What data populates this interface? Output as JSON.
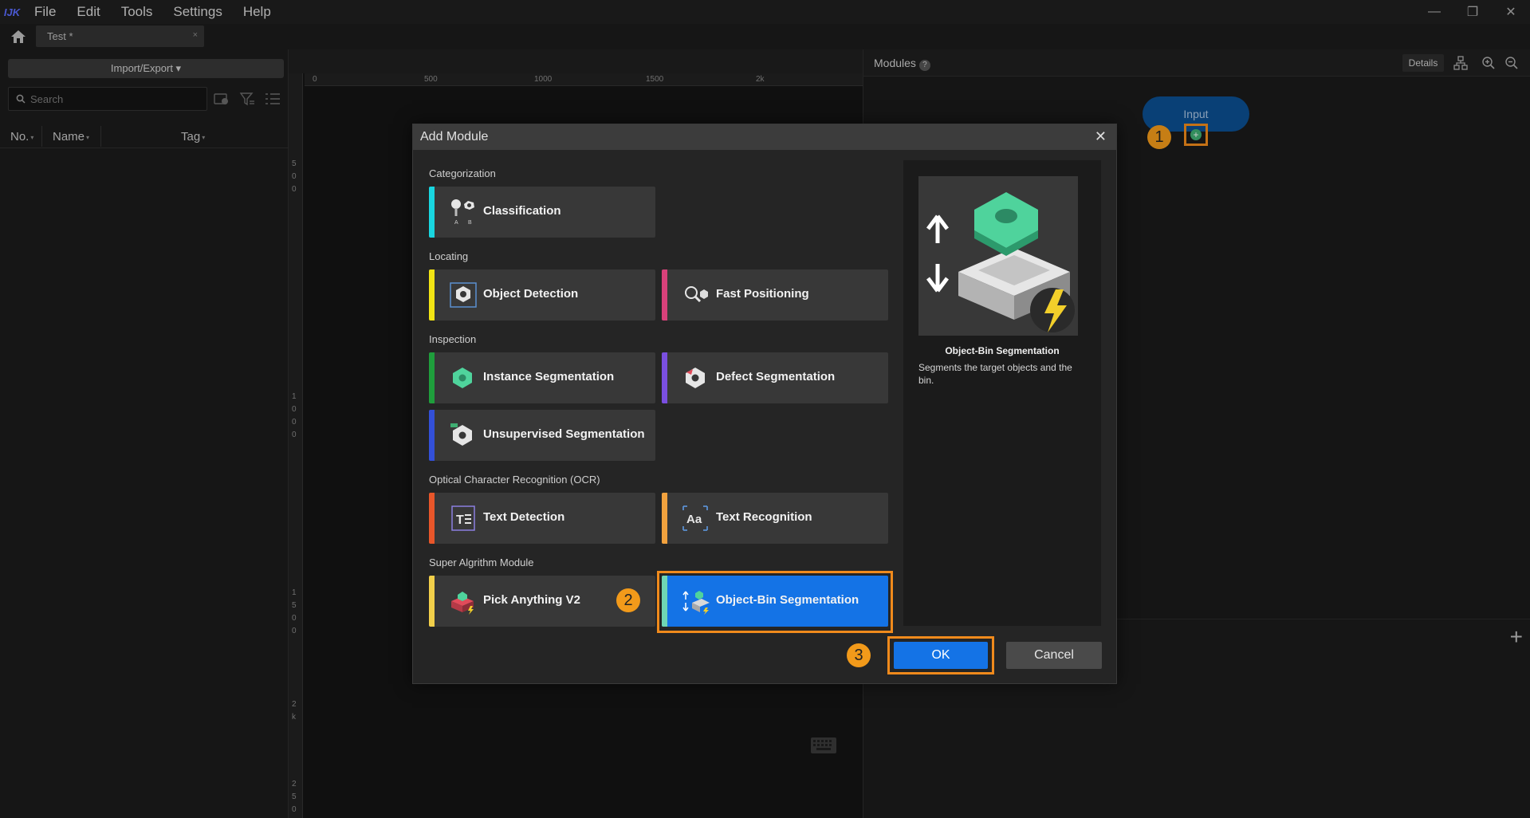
{
  "app": {
    "logo_text": "IJK"
  },
  "menubar": {
    "items": [
      "File",
      "Edit",
      "Tools",
      "Settings",
      "Help"
    ]
  },
  "window_controls": {
    "minimize": "—",
    "restore": "❐",
    "close": "✕"
  },
  "tabs": {
    "doc_tab_label": "Test *",
    "doc_tab_close": "×"
  },
  "left_panel": {
    "import_export_label": "Import/Export ▾",
    "search_placeholder": "Search",
    "columns": {
      "no": "No.",
      "name": "Name",
      "tag": "Tag"
    },
    "sort_glyph": "▾"
  },
  "canvas": {
    "ruler_h_labels": [
      "0",
      "500",
      "1000",
      "1500",
      "2k"
    ],
    "ruler_v_labels": [
      "5",
      "0",
      "0",
      "1",
      "0",
      "0",
      "0",
      "1",
      "5",
      "0",
      "0",
      "2",
      "k",
      "2",
      "5",
      "0"
    ]
  },
  "modules_panel": {
    "title": "Modules",
    "help_glyph": "?",
    "details_label": "Details",
    "input_node_label": "Input",
    "add_glyph": "+",
    "plus_glyph": "+"
  },
  "callouts": {
    "one": "1",
    "two": "2",
    "three": "3"
  },
  "dialog": {
    "title": "Add Module",
    "close_glyph": "✕",
    "sections": {
      "categorization": "Categorization",
      "locating": "Locating",
      "inspection": "Inspection",
      "ocr": "Optical Character Recognition (OCR)",
      "super": "Super Algrithm Module"
    },
    "modules": {
      "classification": "Classification",
      "object_detection": "Object Detection",
      "fast_positioning": "Fast Positioning",
      "instance_segmentation": "Instance Segmentation",
      "defect_segmentation": "Defect Segmentation",
      "unsupervised_segmentation": "Unsupervised Segmentation",
      "text_detection": "Text Detection",
      "text_recognition": "Text Recognition",
      "pick_anything": "Pick Anything V2",
      "object_bin": "Object-Bin Segmentation"
    },
    "preview": {
      "title": "Object-Bin Segmentation",
      "description": "Segments the target objects and the bin."
    },
    "ok_label": "OK",
    "cancel_label": "Cancel"
  },
  "colors": {
    "accent_blue": "#1473e6",
    "callout_orange": "#f29a1a",
    "highlight_frame": "#f08a1c",
    "classification": "#19d6e0",
    "object_detection": "#f2e414",
    "fast_positioning": "#d8417a",
    "instance_segmentation": "#1f9e3c",
    "defect_segmentation": "#7a4fe0",
    "unsupervised_segmentation": "#3350d8",
    "text_detection": "#e8562a",
    "text_recognition": "#f2a23e",
    "pick_anything": "#f2cf4a",
    "object_bin": "#6fd6b4"
  }
}
